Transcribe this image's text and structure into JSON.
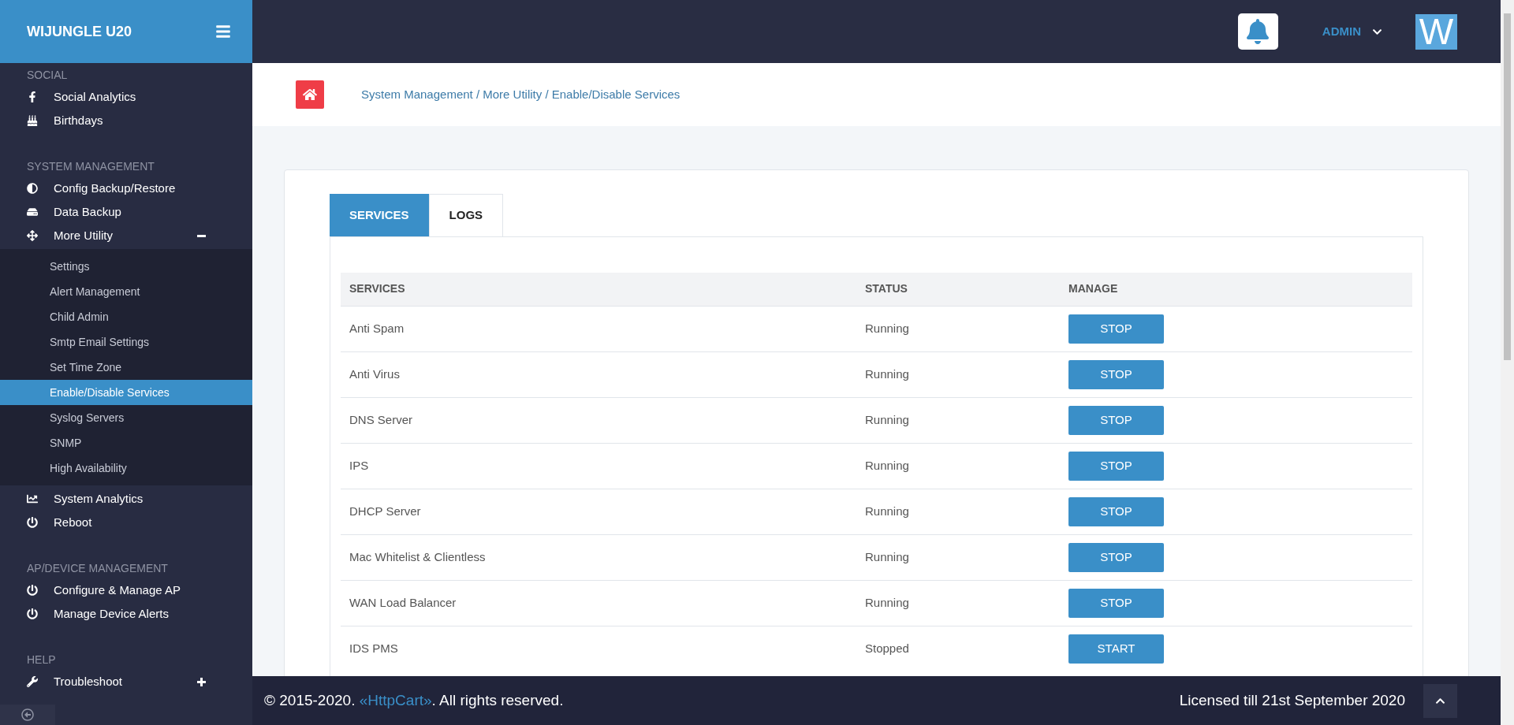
{
  "sidebar": {
    "brand": "WIJUNGLE U20",
    "groups": [
      {
        "heading": "SOCIAL",
        "items": [
          {
            "label": "Social Analytics"
          },
          {
            "label": "Birthdays"
          }
        ]
      },
      {
        "heading": "SYSTEM MANAGEMENT",
        "items": [
          {
            "label": "Config Backup/Restore"
          },
          {
            "label": "Data Backup"
          },
          {
            "label": "More Utility",
            "expanded": true,
            "children": [
              {
                "label": "Settings",
                "selected": false
              },
              {
                "label": "Alert Management",
                "selected": false
              },
              {
                "label": "Child Admin",
                "selected": false
              },
              {
                "label": "Smtp Email Settings",
                "selected": false
              },
              {
                "label": "Set Time Zone",
                "selected": false
              },
              {
                "label": "Enable/Disable Services",
                "selected": true
              },
              {
                "label": "Syslog Servers",
                "selected": false
              },
              {
                "label": "SNMP",
                "selected": false
              },
              {
                "label": "High Availability",
                "selected": false
              }
            ]
          },
          {
            "label": "System Analytics"
          },
          {
            "label": "Reboot"
          }
        ]
      },
      {
        "heading": "AP/DEVICE MANAGEMENT",
        "items": [
          {
            "label": "Configure & Manage AP"
          },
          {
            "label": "Manage Device Alerts"
          }
        ]
      },
      {
        "heading": "HELP",
        "items": [
          {
            "label": "Troubleshoot",
            "expanded": false
          }
        ]
      }
    ]
  },
  "header": {
    "user": "ADMIN",
    "avatar_letter": "W"
  },
  "breadcrumb": "System Management / More Utility / Enable/Disable Services",
  "tabs": [
    {
      "label": "SERVICES",
      "selected": true
    },
    {
      "label": "LOGS",
      "selected": false
    }
  ],
  "table": {
    "columns": [
      "SERVICES",
      "STATUS",
      "MANAGE"
    ],
    "rows": [
      {
        "service": "Anti Spam",
        "status": "Running",
        "action": "STOP"
      },
      {
        "service": "Anti Virus",
        "status": "Running",
        "action": "STOP"
      },
      {
        "service": "DNS Server",
        "status": "Running",
        "action": "STOP"
      },
      {
        "service": "IPS",
        "status": "Running",
        "action": "STOP"
      },
      {
        "service": "DHCP Server",
        "status": "Running",
        "action": "STOP"
      },
      {
        "service": "Mac Whitelist & Clientless",
        "status": "Running",
        "action": "STOP"
      },
      {
        "service": "WAN Load Balancer",
        "status": "Running",
        "action": "STOP"
      },
      {
        "service": "IDS PMS",
        "status": "Stopped",
        "action": "START"
      }
    ]
  },
  "footer": {
    "copyright_prefix": "© 2015-2020.",
    "link": "«HttpCart»",
    "copyright_suffix": ". All rights reserved.",
    "license": "Licensed till 21st September 2020"
  }
}
